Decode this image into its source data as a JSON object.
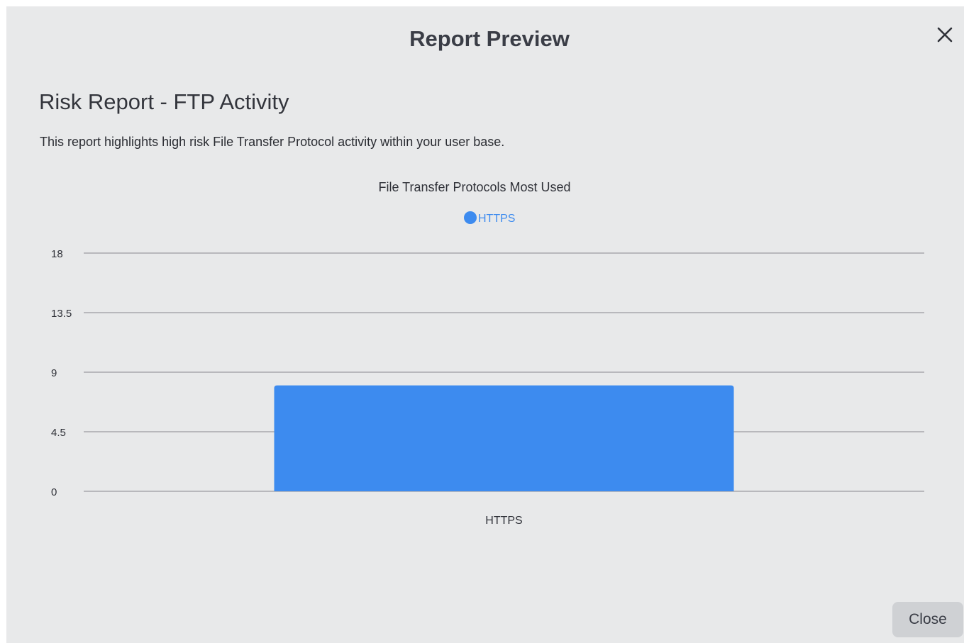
{
  "modal": {
    "title": "Report Preview",
    "close_icon": "close-icon",
    "close_button_label": "Close"
  },
  "report": {
    "title": "Risk Report - FTP Activity",
    "description": "This report highlights high risk File Transfer Protocol activity within your user base."
  },
  "colors": {
    "modal_background": "#e8e9ea",
    "bar": "#3d8bef",
    "gridline": "#9a9ca0",
    "legend_text": "#3d8bef"
  },
  "chart_data": {
    "type": "bar",
    "title": "File Transfer Protocols Most Used",
    "categories": [
      "HTTPS"
    ],
    "series": [
      {
        "name": "HTTPS",
        "values": [
          8
        ]
      }
    ],
    "ylim": [
      0,
      18
    ],
    "yticks": [
      "0",
      "4.5",
      "9",
      "13.5",
      "18"
    ],
    "grid": true,
    "legend_position": "top-center"
  }
}
